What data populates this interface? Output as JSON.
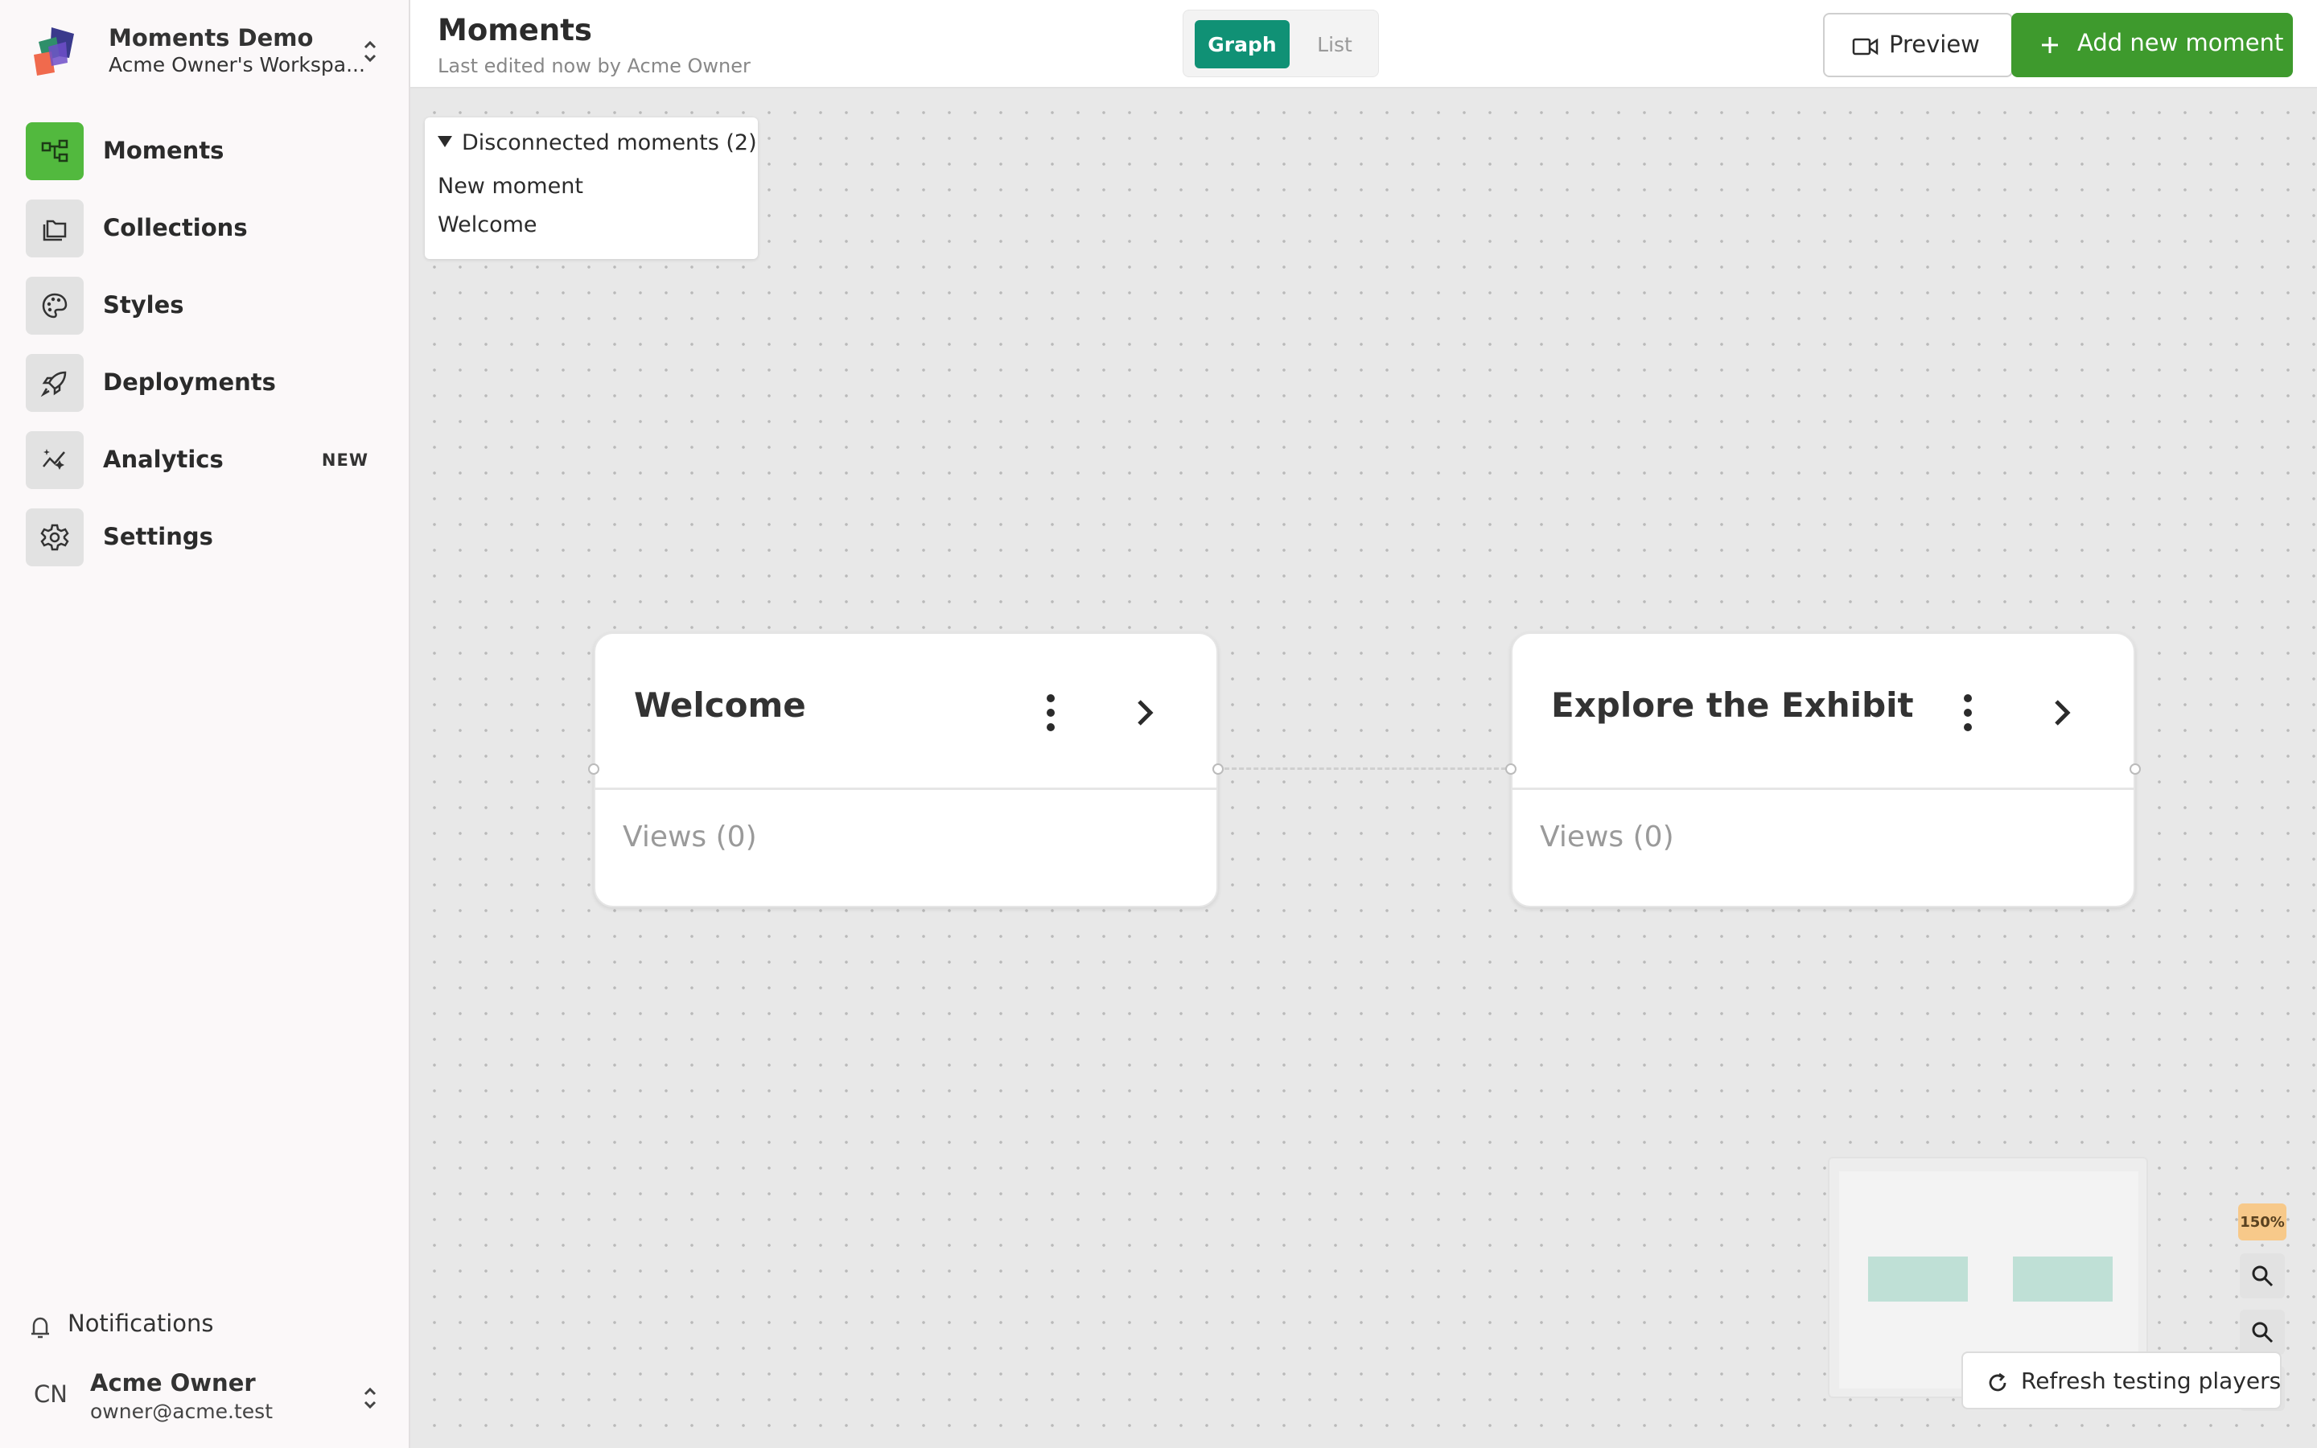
{
  "workspace": {
    "name": "Moments Demo",
    "subtitle": "Acme Owner's Workspa..."
  },
  "sidebar": {
    "items": [
      {
        "label": "Moments",
        "icon": "graph-icon",
        "active": true
      },
      {
        "label": "Collections",
        "icon": "folders-icon"
      },
      {
        "label": "Styles",
        "icon": "palette-icon"
      },
      {
        "label": "Deployments",
        "icon": "rocket-icon"
      },
      {
        "label": "Analytics",
        "icon": "analytics-icon",
        "badge": "NEW"
      },
      {
        "label": "Settings",
        "icon": "gear-icon"
      }
    ],
    "notifications_label": "Notifications"
  },
  "user": {
    "initials": "CN",
    "name": "Acme Owner",
    "email": "owner@acme.test"
  },
  "header": {
    "title": "Moments",
    "subtitle": "Last edited now by Acme Owner",
    "view_toggle": {
      "graph": "Graph",
      "list": "List",
      "selected": "Graph"
    },
    "preview_label": "Preview",
    "add_label": "Add new moment"
  },
  "canvas": {
    "disconnected": {
      "title": "Disconnected moments (2)",
      "items": [
        "New moment",
        "Welcome"
      ]
    },
    "nodes": [
      {
        "title": "Welcome",
        "views": "Views (0)"
      },
      {
        "title": "Explore the Exhibit",
        "views": "Views (0)"
      }
    ],
    "zoom": "150%",
    "refresh_label": "Refresh testing players"
  },
  "colors": {
    "accent_green": "#3e9a2d",
    "active_nav": "#52b93e",
    "toggle_active": "#109175",
    "zoom_badge": "#f7c98a"
  }
}
